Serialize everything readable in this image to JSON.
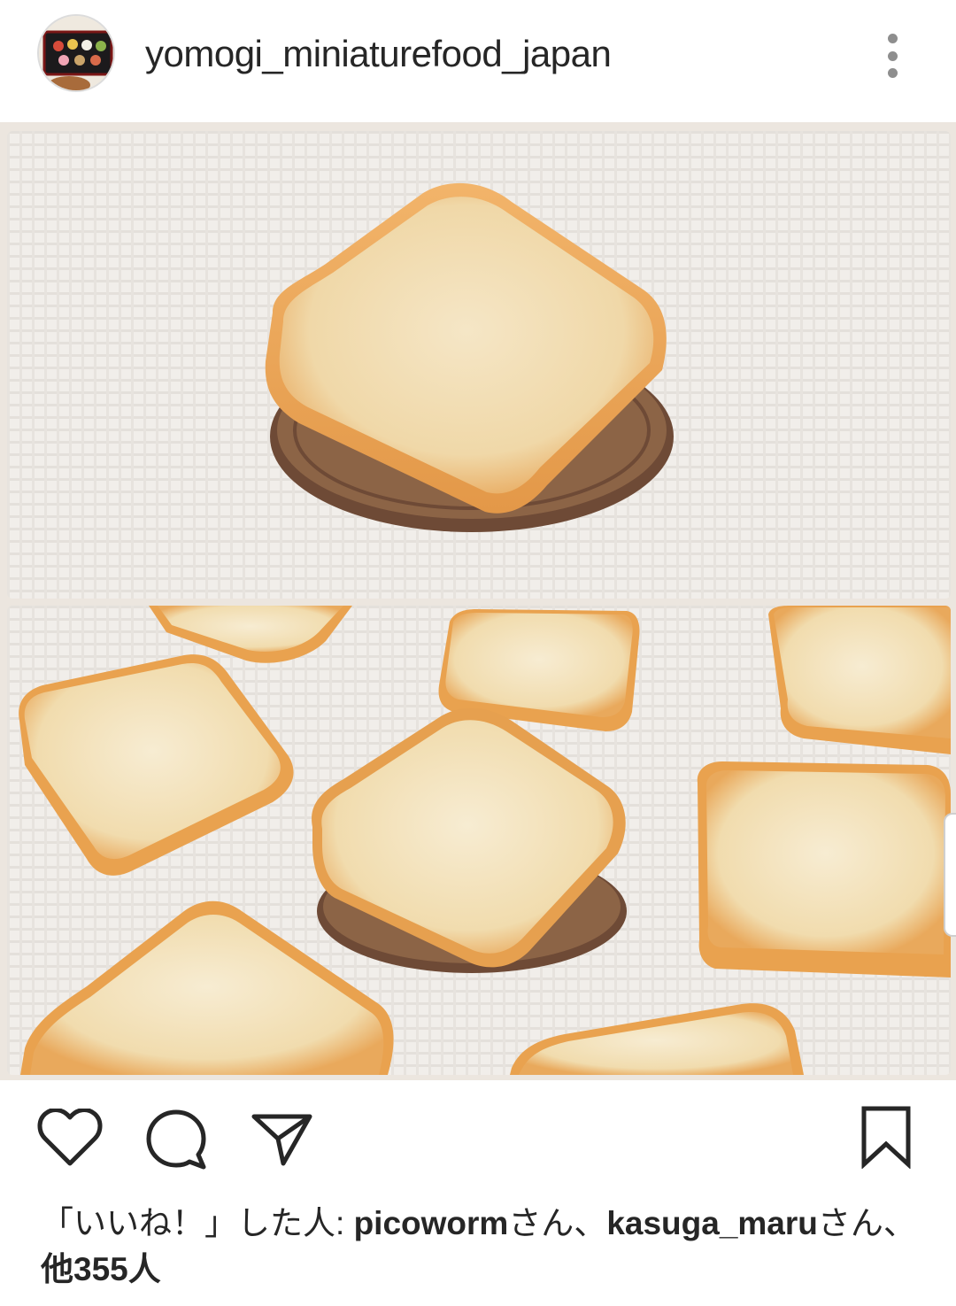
{
  "post": {
    "username": "yomogi_miniaturefood_japan",
    "avatar_icon": "wagashi-tray-avatar",
    "more_icon": "more-vertical-icon"
  },
  "photos": [
    {
      "name": "toast-on-coin-closeup"
    },
    {
      "name": "toast-pieces-on-coin"
    }
  ],
  "actions": {
    "like_icon": "heart-icon",
    "comment_icon": "comment-bubble-icon",
    "share_icon": "paper-plane-icon",
    "save_icon": "bookmark-icon"
  },
  "likes": {
    "prefix": "「いいね！」した人: ",
    "user1": "picoworm",
    "suffix1": "さん、",
    "user2": "kasuga_maru",
    "suffix2": "さん、",
    "others": "他355人"
  },
  "colors": {
    "icon": "#262626",
    "separator": "#ece6df",
    "muted_icon": "#8e8e8e"
  }
}
